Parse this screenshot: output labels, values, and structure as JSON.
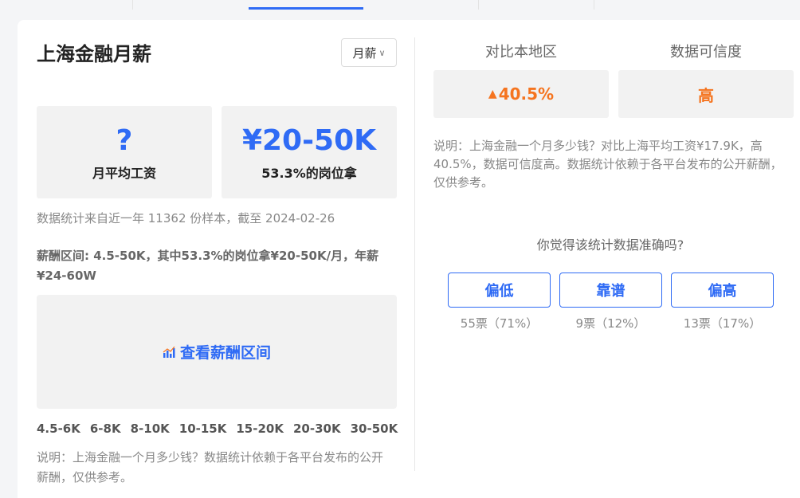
{
  "card": {
    "title": "上海金融月薪",
    "period_select": "月薪",
    "avg_salary": {
      "value": "?",
      "label": "月平均工资"
    },
    "top_range": {
      "value": "¥20-50K",
      "label": "53.3%的岗位拿"
    },
    "source_note": "数据统计来自近一年 11362 份样本，截至 2024-02-26",
    "range_desc": "薪酬区间: 4.5-50K，其中53.3%的岗位拿¥20-50K/月，年薪¥24-60W",
    "view_range_label": "查看薪酬区间",
    "range_ticks": [
      "4.5-6K",
      "6-8K",
      "8-10K",
      "10-15K",
      "15-20K",
      "20-30K",
      "30-50K"
    ],
    "left_note": "说明：上海金融一个月多少钱？数据统计依赖于各平台发布的公开薪酬，仅供参考。"
  },
  "compare": {
    "header_region": "对比本地区",
    "header_credibility": "数据可信度",
    "region_delta": "40.5%",
    "credibility": "高",
    "note": "说明：上海金融一个月多少钱？对比上海平均工资¥17.9K，高 40.5%，数据可信度高。数据统计依赖于各平台发布的公开薪酬，仅供参考。",
    "question": "你觉得该统计数据准确吗?",
    "votes": [
      {
        "label": "偏低",
        "count": "55票（71%）"
      },
      {
        "label": "靠谱",
        "count": "9票（12%）"
      },
      {
        "label": "偏高",
        "count": "13票（17%）"
      }
    ]
  },
  "colors": {
    "accent": "#2f6bf5",
    "positive": "#f5741f",
    "panel": "#f2f2f2"
  },
  "icons": {
    "select": "chevron-down-icon",
    "range": "bar-chart-icon",
    "delta": "arrow-up-icon"
  }
}
